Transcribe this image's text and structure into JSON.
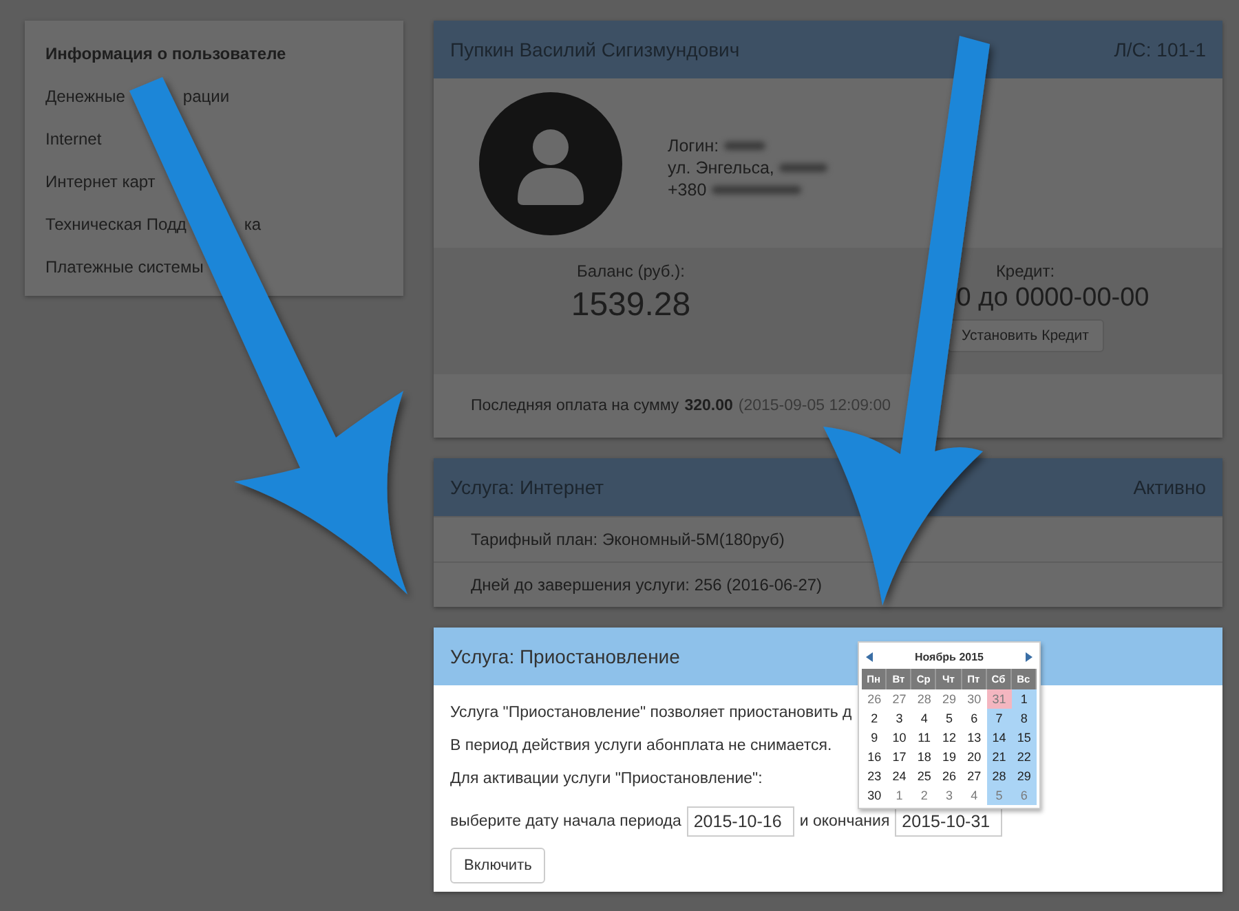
{
  "sidebar": {
    "items": [
      {
        "label": "Информация о пользователе",
        "selected": true
      },
      {
        "label": "Денежные",
        "label_end": "рации",
        "selected": false
      },
      {
        "label": "Internet",
        "selected": false
      },
      {
        "label": "Интернет карт",
        "selected": false
      },
      {
        "label": "Техническая Подд",
        "label_end": "ка",
        "selected": false
      },
      {
        "label": "Платежные системы",
        "selected": false
      }
    ]
  },
  "account": {
    "name": "Пупкин Василий Сигизмундович",
    "account_no": "Л/С: 101-1",
    "login_label": "Логин:",
    "address": "ул. Энгельса,",
    "phone": "+380",
    "balance_label": "Баланс (руб.):",
    "balance": "1539.28",
    "credit_label": "Кредит:",
    "credit_value": "0 до 0000-00-00",
    "credit_button": "Установить Кредит",
    "last_payment_label": "Последняя оплата на сумму",
    "last_payment_amount": "320.00",
    "last_payment_date": "(2015-09-05 12:09:00"
  },
  "internet_service": {
    "title": "Услуга: Интернет",
    "status": "Активно",
    "rows": [
      "Тарифный план: Экономный-5М(180руб)",
      "Дней до завершения услуги: 256 (2016-06-27)"
    ]
  },
  "suspend_service": {
    "title": "Услуга: Приостановление",
    "lines": [
      "Услуга \"Приостановление\" позволяет приостановить д",
      "В период действия услуги абонплата не снимается.",
      "Для активации услуги \"Приостановление\":"
    ],
    "prompt": "выберите дату начала периода",
    "start_date": "2015-10-16",
    "and_label": "и окончания",
    "end_date": "2015-10-31",
    "button": "Включить"
  },
  "calendar": {
    "month": "Ноябрь 2015",
    "weekdays": [
      "Пн",
      "Вт",
      "Ср",
      "Чт",
      "Пт",
      "Сб",
      "Вс"
    ],
    "weeks": [
      [
        {
          "d": "26",
          "muted": true,
          "weekend": false,
          "selected": false
        },
        {
          "d": "27",
          "muted": true,
          "weekend": false,
          "selected": false
        },
        {
          "d": "28",
          "muted": true,
          "weekend": false,
          "selected": false
        },
        {
          "d": "29",
          "muted": true,
          "weekend": false,
          "selected": false
        },
        {
          "d": "30",
          "muted": true,
          "weekend": false,
          "selected": false
        },
        {
          "d": "31",
          "muted": true,
          "weekend": true,
          "selected": true
        },
        {
          "d": "1",
          "muted": false,
          "weekend": true,
          "selected": false
        }
      ],
      [
        {
          "d": "2",
          "muted": false,
          "weekend": false,
          "selected": false
        },
        {
          "d": "3",
          "muted": false,
          "weekend": false,
          "selected": false
        },
        {
          "d": "4",
          "muted": false,
          "weekend": false,
          "selected": false
        },
        {
          "d": "5",
          "muted": false,
          "weekend": false,
          "selected": false
        },
        {
          "d": "6",
          "muted": false,
          "weekend": false,
          "selected": false
        },
        {
          "d": "7",
          "muted": false,
          "weekend": true,
          "selected": false
        },
        {
          "d": "8",
          "muted": false,
          "weekend": true,
          "selected": false
        }
      ],
      [
        {
          "d": "9",
          "muted": false,
          "weekend": false,
          "selected": false
        },
        {
          "d": "10",
          "muted": false,
          "weekend": false,
          "selected": false
        },
        {
          "d": "11",
          "muted": false,
          "weekend": false,
          "selected": false
        },
        {
          "d": "12",
          "muted": false,
          "weekend": false,
          "selected": false
        },
        {
          "d": "13",
          "muted": false,
          "weekend": false,
          "selected": false
        },
        {
          "d": "14",
          "muted": false,
          "weekend": true,
          "selected": false
        },
        {
          "d": "15",
          "muted": false,
          "weekend": true,
          "selected": false
        }
      ],
      [
        {
          "d": "16",
          "muted": false,
          "weekend": false,
          "selected": false
        },
        {
          "d": "17",
          "muted": false,
          "weekend": false,
          "selected": false
        },
        {
          "d": "18",
          "muted": false,
          "weekend": false,
          "selected": false
        },
        {
          "d": "19",
          "muted": false,
          "weekend": false,
          "selected": false
        },
        {
          "d": "20",
          "muted": false,
          "weekend": false,
          "selected": false
        },
        {
          "d": "21",
          "muted": false,
          "weekend": true,
          "selected": false
        },
        {
          "d": "22",
          "muted": false,
          "weekend": true,
          "selected": false
        }
      ],
      [
        {
          "d": "23",
          "muted": false,
          "weekend": false,
          "selected": false
        },
        {
          "d": "24",
          "muted": false,
          "weekend": false,
          "selected": false
        },
        {
          "d": "25",
          "muted": false,
          "weekend": false,
          "selected": false
        },
        {
          "d": "26",
          "muted": false,
          "weekend": false,
          "selected": false
        },
        {
          "d": "27",
          "muted": false,
          "weekend": false,
          "selected": false
        },
        {
          "d": "28",
          "muted": false,
          "weekend": true,
          "selected": false
        },
        {
          "d": "29",
          "muted": false,
          "weekend": true,
          "selected": false
        }
      ],
      [
        {
          "d": "30",
          "muted": false,
          "weekend": false,
          "selected": false
        },
        {
          "d": "1",
          "muted": true,
          "weekend": false,
          "selected": false
        },
        {
          "d": "2",
          "muted": true,
          "weekend": false,
          "selected": false
        },
        {
          "d": "3",
          "muted": true,
          "weekend": false,
          "selected": false
        },
        {
          "d": "4",
          "muted": true,
          "weekend": false,
          "selected": false
        },
        {
          "d": "5",
          "muted": true,
          "weekend": true,
          "selected": false
        },
        {
          "d": "6",
          "muted": true,
          "weekend": true,
          "selected": false
        }
      ]
    ]
  }
}
